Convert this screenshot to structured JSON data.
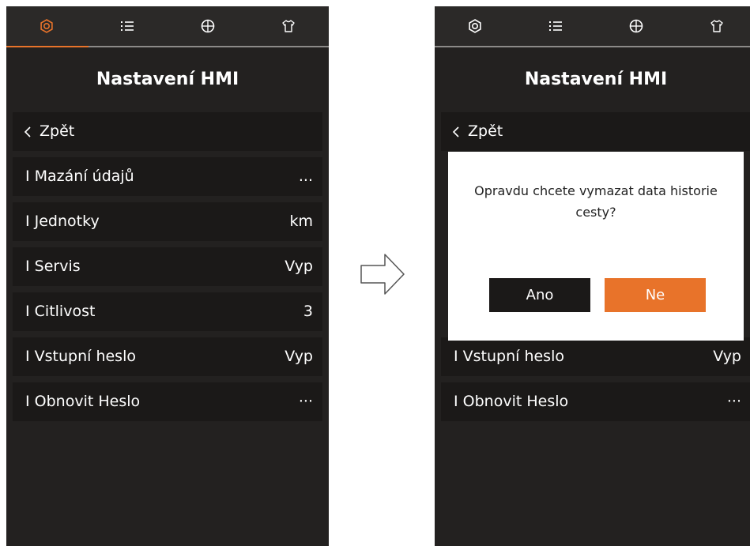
{
  "colors": {
    "accent": "#e8732a",
    "screen_bg": "#232120",
    "row_bg": "#1b1918",
    "dialog_bg": "#ffffff"
  },
  "tabs": [
    {
      "icon": "gear-icon",
      "active": true
    },
    {
      "icon": "list-icon",
      "active": false
    },
    {
      "icon": "globe-icon",
      "active": false
    },
    {
      "icon": "shirt-icon",
      "active": false
    }
  ],
  "title": "Nastavení HMI",
  "back_label": "Zpět",
  "rows": [
    {
      "label": "I Mazání údajů",
      "value": "..."
    },
    {
      "label": "I Jednotky",
      "value": "km"
    },
    {
      "label": "I Servis",
      "value": "Vyp"
    },
    {
      "label": "I Citlivost",
      "value": "3"
    },
    {
      "label": "I Vstupní heslo",
      "value": "Vyp"
    },
    {
      "label": "I Obnovit Heslo",
      "value": "···"
    }
  ],
  "dialog": {
    "message_line1": "Opravdu chcete vymazat data historie",
    "message_line2": "cesty?",
    "yes_label": "Ano",
    "no_label": "Ne"
  }
}
